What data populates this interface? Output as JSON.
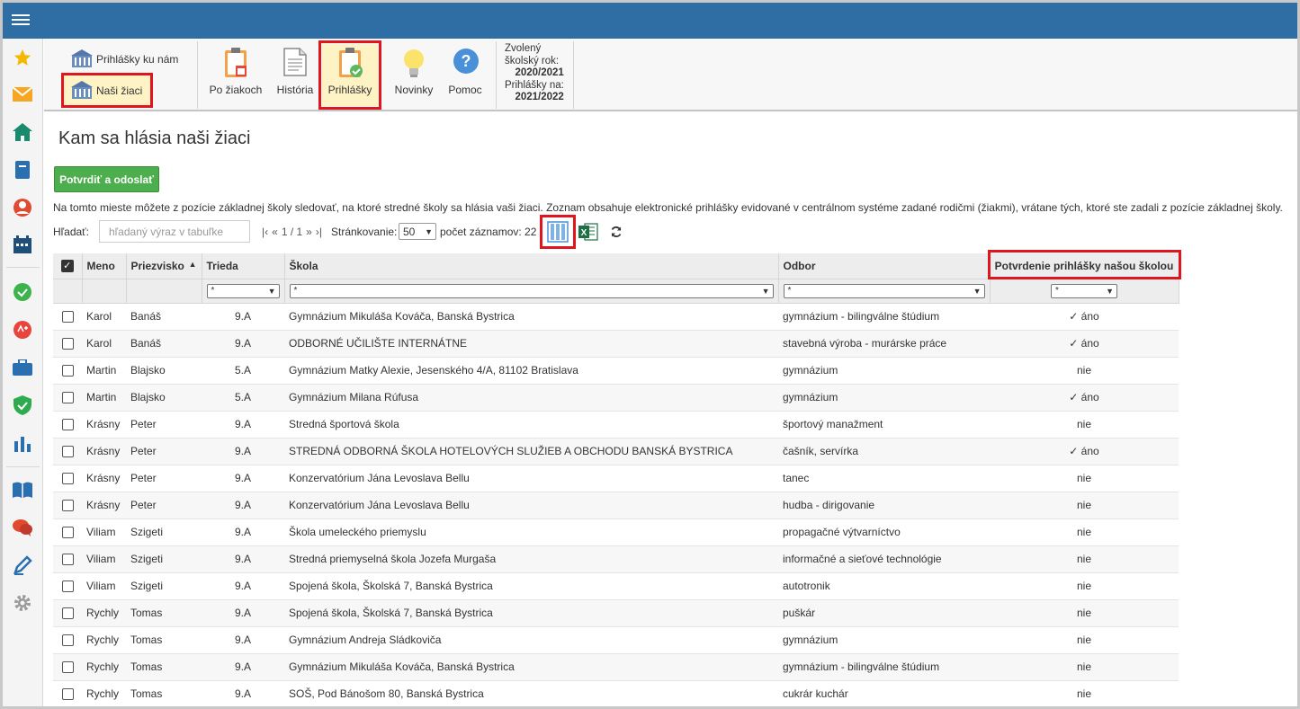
{
  "toolbar": {
    "link_applications_to_us": "Prihlášky ku nám",
    "link_our_students": "Naši žiaci",
    "buttons": [
      {
        "label": "Po žiakoch"
      },
      {
        "label": "História"
      },
      {
        "label": "Prihlášky"
      },
      {
        "label": "Novinky"
      },
      {
        "label": "Pomoc"
      }
    ],
    "year_info": {
      "selected_label_1": "Zvolený",
      "selected_label_2": "školský rok:",
      "selected_value": "2020/2021",
      "apps_label": "Prihlášky na:",
      "apps_value": "2021/2022"
    }
  },
  "sidebar": {
    "icons": [
      "star-icon",
      "envelope-icon",
      "home-icon",
      "notebook-icon",
      "user-icon",
      "calendar-icon",
      "check-circle-icon",
      "attendance-icon",
      "briefcase-icon",
      "shield-icon",
      "bar-chart-icon",
      "book-icon",
      "chat-icon",
      "pen-icon",
      "gear-icon"
    ]
  },
  "page": {
    "title": "Kam sa hlásia naši žiaci",
    "confirm_button": "Potvrdiť a odoslať",
    "description": "Na tomto mieste môžete z pozície základnej školy sledovať, na ktoré stredné školy sa hlásia vaši žiaci. Zoznam obsahuje elektronické prihlášky evidované v centrálnom systéme zadané rodičmi (žiakmi), vrátane tých, ktoré ste zadali z pozície základnej školy.",
    "search_label": "Hľadať:",
    "search_placeholder": "hľadaný výraz v tabuľke",
    "pager": {
      "first": "|‹",
      "prev": "«",
      "info": "1 / 1",
      "next": "»",
      "last": "›|"
    },
    "paging_label": "Stránkovanie:",
    "paging_value": "50",
    "count_label": "počet záznamov: 22"
  },
  "table": {
    "headers": {
      "name": "Meno",
      "surname": "Priezvisko",
      "class": "Trieda",
      "school": "Škola",
      "field": "Odbor",
      "confirmation": "Potvrdenie prihlášky našou školou"
    },
    "filter_value": "*",
    "rows": [
      {
        "name": "Karol",
        "surname": "Banáš",
        "class": "9.A",
        "school": "Gymnázium Mikuláša Kováča, Banská Bystrica",
        "field": "gymnázium - bilingválne štúdium",
        "confirm": "✓ áno"
      },
      {
        "name": "Karol",
        "surname": "Banáš",
        "class": "9.A",
        "school": "ODBORNÉ UČILIŠTE INTERNÁTNE",
        "field": "stavebná výroba - murárske práce",
        "confirm": "✓ áno"
      },
      {
        "name": "Martin",
        "surname": "Blajsko",
        "class": "5.A",
        "school": "Gymnázium Matky Alexie, Jesenského 4/A, 81102 Bratislava",
        "field": "gymnázium",
        "confirm": "nie"
      },
      {
        "name": "Martin",
        "surname": "Blajsko",
        "class": "5.A",
        "school": "Gymnázium Milana Rúfusa",
        "field": "gymnázium",
        "confirm": "✓ áno"
      },
      {
        "name": "Krásny",
        "surname": "Peter",
        "class": "9.A",
        "school": "Stredná športová škola",
        "field": "športový manažment",
        "confirm": "nie"
      },
      {
        "name": "Krásny",
        "surname": "Peter",
        "class": "9.A",
        "school": "STREDNÁ ODBORNÁ ŠKOLA HOTELOVÝCH SLUŽIEB A OBCHODU BANSKÁ BYSTRICA",
        "field": "čašník, servírka",
        "confirm": "✓ áno"
      },
      {
        "name": "Krásny",
        "surname": "Peter",
        "class": "9.A",
        "school": "Konzervatórium Jána Levoslava Bellu",
        "field": "tanec",
        "confirm": "nie"
      },
      {
        "name": "Krásny",
        "surname": "Peter",
        "class": "9.A",
        "school": "Konzervatórium Jána Levoslava Bellu",
        "field": "hudba - dirigovanie",
        "confirm": "nie"
      },
      {
        "name": "Viliam",
        "surname": "Szigeti",
        "class": "9.A",
        "school": "Škola umeleckého priemyslu",
        "field": "propagačné výtvarníctvo",
        "confirm": "nie"
      },
      {
        "name": "Viliam",
        "surname": "Szigeti",
        "class": "9.A",
        "school": "Stredná priemyselná škola Jozefa Murgaša",
        "field": "informačné a sieťové technológie",
        "confirm": "nie"
      },
      {
        "name": "Viliam",
        "surname": "Szigeti",
        "class": "9.A",
        "school": "Spojená škola, Školská 7, Banská Bystrica",
        "field": "autotronik",
        "confirm": "nie"
      },
      {
        "name": "Rychly",
        "surname": "Tomas",
        "class": "9.A",
        "school": "Spojená škola, Školská 7, Banská Bystrica",
        "field": "puškár",
        "confirm": "nie"
      },
      {
        "name": "Rychly",
        "surname": "Tomas",
        "class": "9.A",
        "school": "Gymnázium Andreja Sládkoviča",
        "field": "gymnázium",
        "confirm": "nie"
      },
      {
        "name": "Rychly",
        "surname": "Tomas",
        "class": "9.A",
        "school": "Gymnázium Mikuláša Kováča, Banská Bystrica",
        "field": "gymnázium - bilingválne štúdium",
        "confirm": "nie"
      },
      {
        "name": "Rychly",
        "surname": "Tomas",
        "class": "9.A",
        "school": "SOŠ, Pod Bánošom 80, Banská Bystrica",
        "field": "cukrár kuchár",
        "confirm": "nie"
      }
    ]
  }
}
